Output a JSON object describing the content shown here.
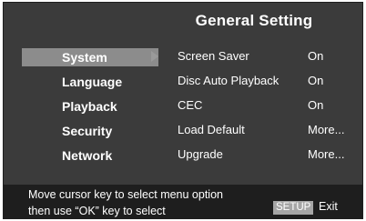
{
  "title": "General Setting",
  "menu": {
    "items": [
      {
        "label": "System",
        "selected": true
      },
      {
        "label": "Language",
        "selected": false
      },
      {
        "label": "Playback",
        "selected": false
      },
      {
        "label": "Security",
        "selected": false
      },
      {
        "label": "Network",
        "selected": false
      }
    ]
  },
  "options": [
    {
      "label": "Screen Saver",
      "value": "On"
    },
    {
      "label": "Disc Auto Playback",
      "value": "On"
    },
    {
      "label": "CEC",
      "value": "On"
    },
    {
      "label": "Load Default",
      "value": "More..."
    },
    {
      "label": "Upgrade",
      "value": "More..."
    }
  ],
  "footer": {
    "help_line1": "Move cursor key to select menu option",
    "help_line2": "then use “OK” key to select",
    "setup_key": "SETUP",
    "exit_label": "Exit"
  },
  "colors": {
    "background": "#3b3b3b",
    "selected_highlight": "#8c8c8c",
    "footer_background": "#1e1e1e",
    "text": "#ffffff"
  },
  "icons": {
    "selection_arrow": "arrow-right-icon"
  }
}
